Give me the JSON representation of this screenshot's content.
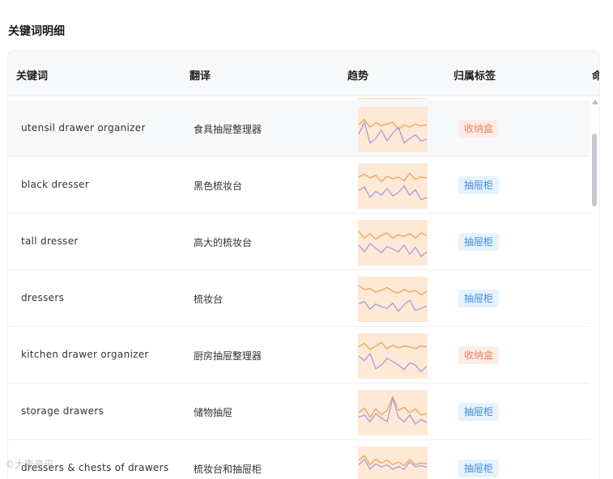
{
  "section": {
    "title": "关键词明细"
  },
  "table": {
    "headers": [
      "关键词",
      "翻译",
      "趋势",
      "归属标签",
      "命"
    ],
    "rows": [
      {
        "keyword": "utensil drawer organizer",
        "translation": "食具抽屉整理器",
        "tag": "收纳盒",
        "trend_a": [
          60,
          72,
          55,
          65,
          58,
          62,
          66,
          50,
          60,
          55,
          62,
          58,
          60
        ],
        "trend_b": [
          40,
          65,
          20,
          30,
          48,
          25,
          42,
          55,
          20,
          30,
          38,
          25,
          28
        ]
      },
      {
        "keyword": "black dresser",
        "translation": "黑色梳妆台",
        "tag": "抽屉柜",
        "trend_a": [
          70,
          76,
          68,
          74,
          60,
          72,
          66,
          70,
          62,
          78,
          65,
          70,
          68
        ],
        "trend_b": [
          40,
          48,
          25,
          38,
          30,
          45,
          28,
          36,
          50,
          30,
          42,
          20,
          25
        ]
      },
      {
        "keyword": "tall dresser",
        "translation": "高大的梳妆台",
        "tag": "抽屉柜",
        "trend_a": [
          75,
          60,
          70,
          58,
          66,
          72,
          60,
          68,
          64,
          70,
          60,
          72,
          66
        ],
        "trend_b": [
          45,
          30,
          48,
          38,
          28,
          42,
          36,
          30,
          45,
          25,
          40,
          20,
          30
        ]
      },
      {
        "keyword": "dressers",
        "translation": "梳妆台",
        "tag": "抽屉柜",
        "trend_a": [
          80,
          72,
          74,
          66,
          70,
          76,
          68,
          64,
          72,
          66,
          70,
          60,
          68
        ],
        "trend_b": [
          40,
          45,
          28,
          40,
          34,
          30,
          42,
          24,
          38,
          48,
          25,
          30,
          35
        ]
      },
      {
        "keyword": "kitchen drawer organizer",
        "translation": "厨房抽屉整理器",
        "tag": "收纳盒",
        "trend_a": [
          70,
          78,
          64,
          72,
          80,
          66,
          74,
          68,
          72,
          70,
          66,
          72,
          70
        ],
        "trend_b": [
          50,
          40,
          55,
          22,
          30,
          45,
          38,
          30,
          20,
          35,
          30,
          15,
          28
        ]
      },
      {
        "keyword": "storage drawers",
        "translation": "储物抽屉",
        "tag": "抽屉柜",
        "trend_a": [
          50,
          60,
          40,
          58,
          45,
          55,
          85,
          55,
          62,
          50,
          58,
          45,
          48
        ],
        "trend_b": [
          40,
          45,
          30,
          48,
          38,
          30,
          82,
          40,
          30,
          45,
          25,
          35,
          28
        ]
      },
      {
        "keyword": "dressers & chests of drawers",
        "translation": "梳妆台和抽屉柜",
        "tag": "抽屉柜",
        "trend_a": [
          70,
          80,
          60,
          72,
          64,
          70,
          60,
          66,
          58,
          72,
          60,
          64,
          62
        ],
        "trend_b": [
          60,
          72,
          50,
          62,
          55,
          60,
          50,
          56,
          50,
          66,
          55,
          58,
          55
        ]
      }
    ]
  },
  "watermark": "©大麦资讯",
  "colors": {
    "spark_fill": "#fde9d6",
    "spark_line_a": "#f2a15a",
    "spark_line_b": "#a99be0",
    "tag_storage_bg": "#fdece6",
    "tag_storage_fg": "#e8855a",
    "tag_drawer_bg": "#e6f2fc",
    "tag_drawer_fg": "#3a8ee0"
  }
}
